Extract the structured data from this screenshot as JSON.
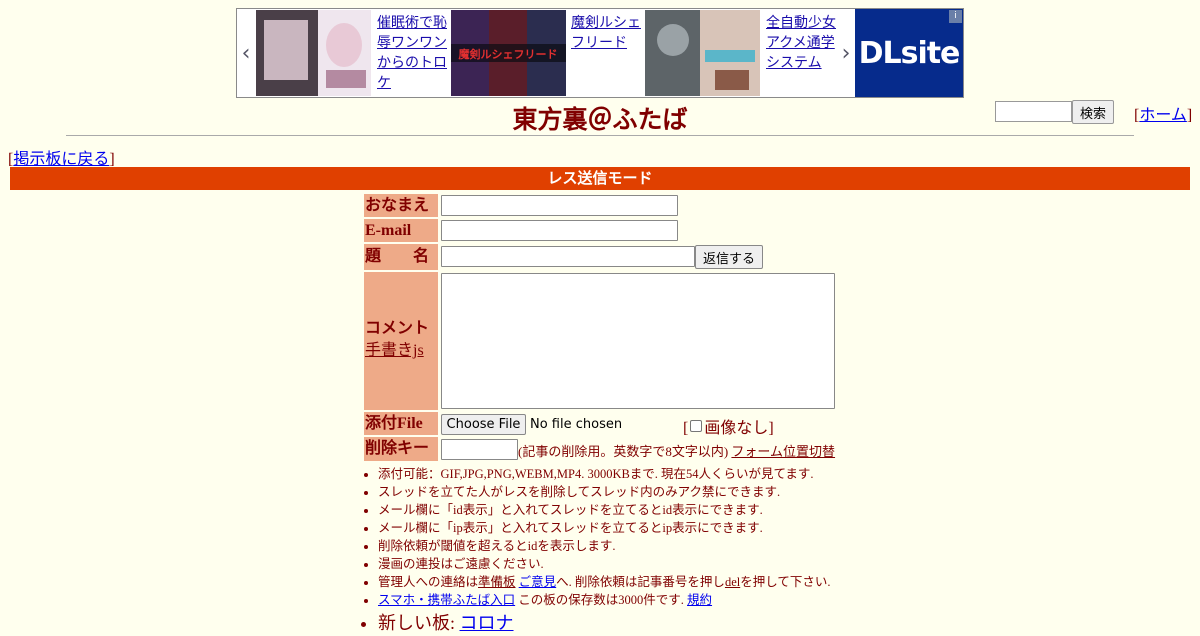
{
  "ad": {
    "items": [
      {
        "text": "催眠術で恥辱ワンワンからのトロケ"
      },
      {
        "text": "魔剣ルシェフリード"
      },
      {
        "text": "全自動少女アクメ通学システム"
      }
    ],
    "thumb_caption_2": "魔剣ルシェフリード",
    "brand": "DLsite",
    "prev_icon": "chevron-left-icon",
    "next_icon": "chevron-right-icon"
  },
  "header": {
    "title": "東方裏＠ふたば",
    "search_button": "検索",
    "home_link": "ホーム",
    "back_link": "掲示板に戻る",
    "bracket_open": "[",
    "bracket_close": "]"
  },
  "mode": {
    "label": "レス送信モード"
  },
  "form": {
    "name_label": "おなまえ",
    "email_label": "E-mail",
    "subject_label": "題　　名",
    "submit_button": "返信する",
    "comment_label": "コメント",
    "handwriting_link": "手書きjs",
    "file_label": "添付File",
    "choose_file_button": "Choose File",
    "no_file_text": "No file chosen",
    "no_image_label": "画像なし",
    "delete_key_label": "削除キー",
    "delete_note": "(記事の削除用。英数字で8文字以内)",
    "form_position_link": "フォーム位置切替"
  },
  "rules": {
    "r1": "添付可能：GIF,JPG,PNG,WEBM,MP4. 3000KBまで. 現在54人くらいが見てます.",
    "r2": "スレッドを立てた人がレスを削除してスレッド内のみアク禁にできます.",
    "r3": "メール欄に「id表示」と入れてスレッドを立てるとid表示にできます.",
    "r4": "メール欄に「ip表示」と入れてスレッドを立てるとip表示にできます.",
    "r5": "削除依頼が閾値を超えるとidを表示します.",
    "r6": "漫画の連投はご遠慮ください.",
    "r7_pre": "管理人への連絡は",
    "r7_link1": "準備板",
    "r7_link2": "ご意見",
    "r7_mid": "へ. 削除依頼は記事番号を押し",
    "r7_link3": "del",
    "r7_post": "を押して下さい.",
    "r8_link1": "スマホ・携帯ふたば入口",
    "r8_mid": " この板の保存数は3000件です. ",
    "r8_link2": "規約"
  },
  "new_board": {
    "label": "新しい板: ",
    "link": "コロナ"
  },
  "colors": {
    "background": "#ffffee",
    "text": "#800000",
    "mode_bar": "#e04000",
    "label_bg": "#eeaa88",
    "ad_brand": "#062b8c"
  }
}
